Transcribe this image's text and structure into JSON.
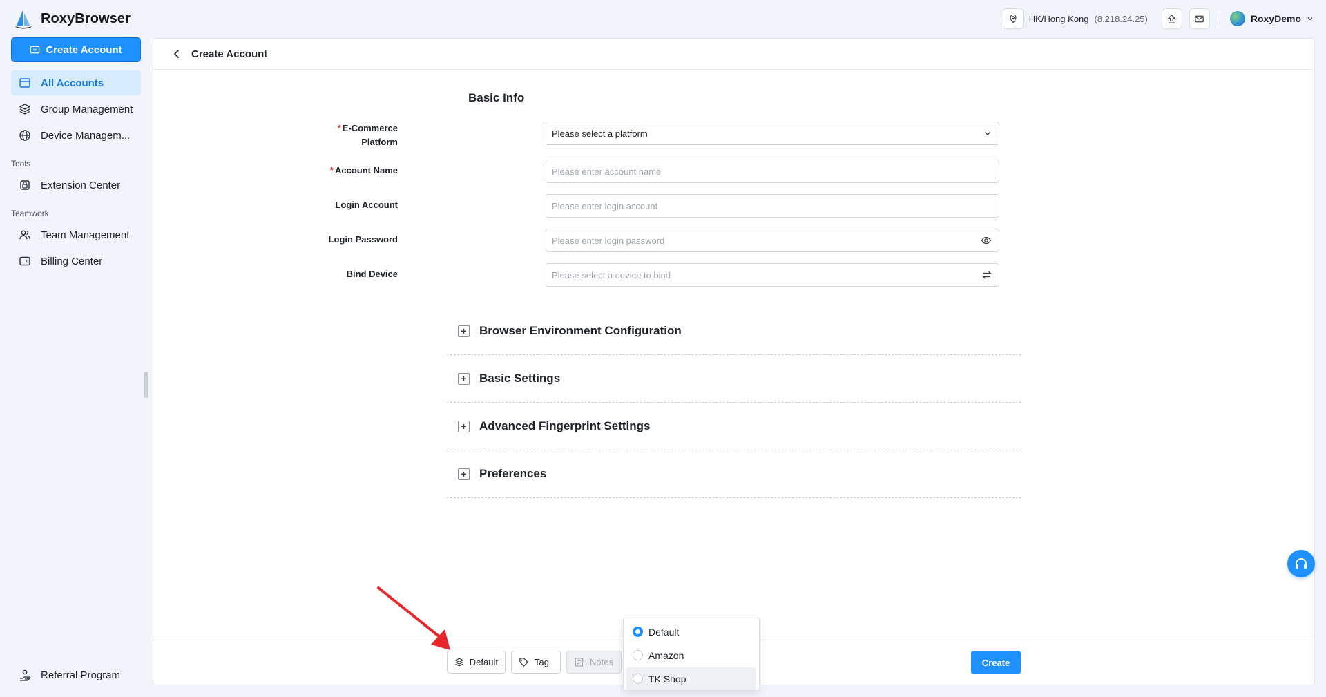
{
  "app": {
    "name": "RoxyBrowser"
  },
  "topbar": {
    "location_label": "HK/Hong Kong",
    "location_ip": "(8.218.24.25)",
    "user_name": "RoxyDemo",
    "icons": [
      "location-pin-icon",
      "upload-icon",
      "mail-icon",
      "chevron-down-icon"
    ]
  },
  "sidebar": {
    "create_button": "Create Account",
    "items": [
      {
        "label": "All Accounts",
        "icon": "card-icon",
        "active": true
      },
      {
        "label": "Group Management",
        "icon": "layers-icon"
      },
      {
        "label": "Device Managem...",
        "icon": "globe-icon"
      }
    ],
    "tools_section": "Tools",
    "tools_items": [
      {
        "label": "Extension Center",
        "icon": "extension-icon"
      }
    ],
    "teamwork_section": "Teamwork",
    "teamwork_items": [
      {
        "label": "Team Management",
        "icon": "team-icon"
      },
      {
        "label": "Billing Center",
        "icon": "wallet-icon"
      }
    ],
    "referral": "Referral Program"
  },
  "page": {
    "back_title": "Create Account",
    "basic_info_title": "Basic Info",
    "fields": {
      "platform": {
        "label_line1": "E-Commerce",
        "label_line2": "Platform",
        "value": "Please select a platform",
        "required": true
      },
      "account_name": {
        "label": "Account Name",
        "placeholder": "Please enter account name",
        "required": true
      },
      "login_account": {
        "label": "Login Account",
        "placeholder": "Please enter login account"
      },
      "login_password": {
        "label": "Login Password",
        "placeholder": "Please enter login password"
      },
      "bind_device": {
        "label": "Bind Device",
        "placeholder": "Please select a device to bind"
      }
    },
    "sections": [
      "Browser Environment Configuration",
      "Basic Settings",
      "Advanced Fingerprint Settings",
      "Preferences"
    ],
    "footer": {
      "group_button": "Default",
      "tag_button": "Tag",
      "notes_button": "Notes",
      "create_button": "Create"
    },
    "group_dropdown": {
      "options": [
        {
          "label": "Default",
          "selected": true
        },
        {
          "label": "Amazon",
          "selected": false
        },
        {
          "label": "TK Shop",
          "selected": false,
          "hovered": true
        }
      ]
    }
  },
  "colors": {
    "primary": "#1e90ff",
    "active_bg": "#d6ebfc",
    "required": "#e5383b"
  }
}
